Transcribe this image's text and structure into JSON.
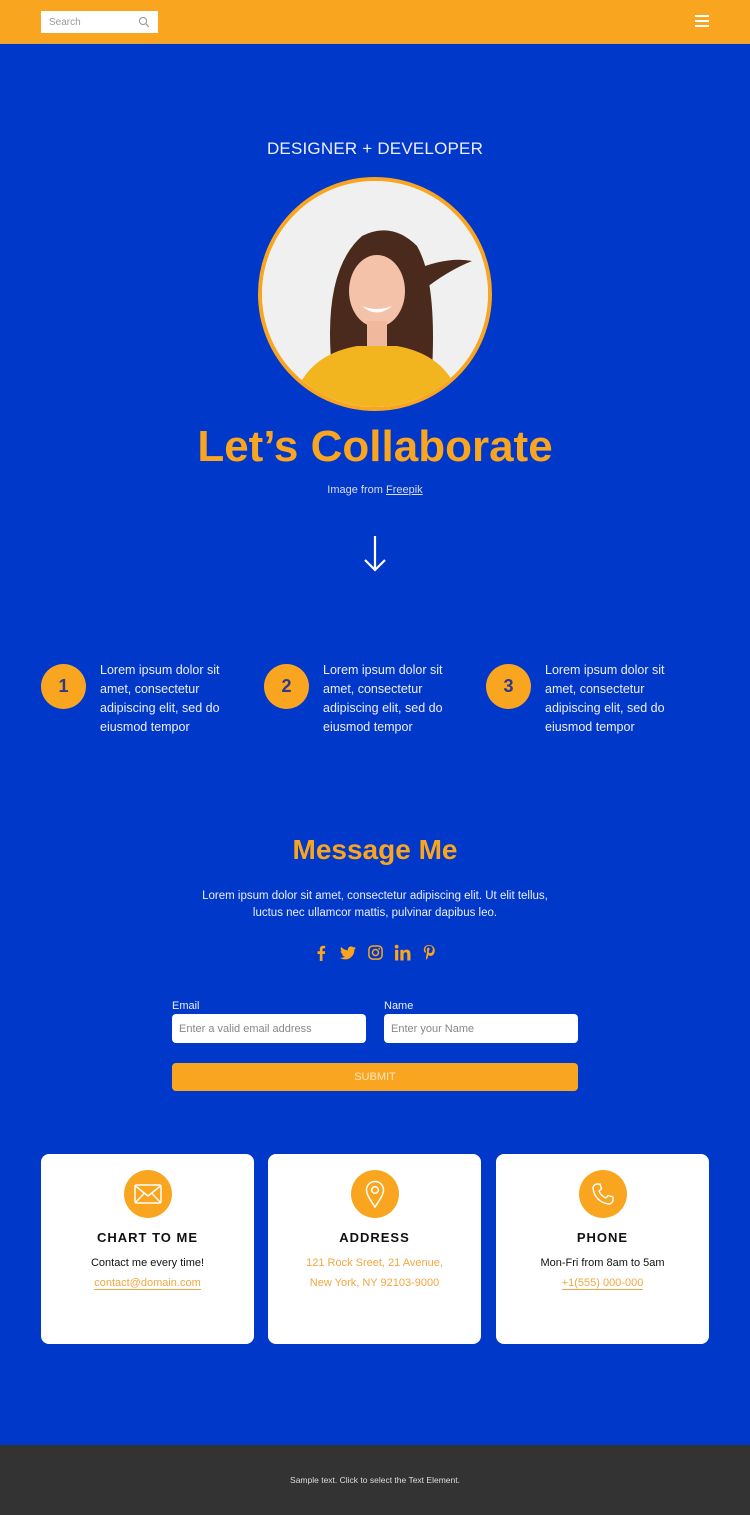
{
  "header": {
    "search_placeholder": "Search",
    "menu_icon": "hamburger-icon",
    "accent": "#faa51f"
  },
  "hero": {
    "tagline": "DESIGNER + DEVELOPER",
    "headline": "Let’s Collaborate",
    "credit_prefix": "Image from",
    "credit_link": "Freepik",
    "portrait_alt": "Smiling woman in yellow shirt",
    "arrow_icon": "arrow-down-icon"
  },
  "steps": [
    {
      "num": "1",
      "text": "Lorem ipsum dolor sit amet, consectetur adipiscing elit, sed do eiusmod tempor"
    },
    {
      "num": "2",
      "text": "Lorem ipsum dolor sit amet, consectetur adipiscing elit, sed do eiusmod tempor"
    },
    {
      "num": "3",
      "text": "Lorem ipsum dolor sit amet, consectetur adipiscing elit, sed do eiusmod tempor"
    }
  ],
  "message": {
    "title": "Message Me",
    "description": "Lorem ipsum dolor sit amet, consectetur adipiscing elit. Ut elit tellus, luctus nec ullamcor mattis, pulvinar dapibus leo.",
    "social": [
      "facebook-icon",
      "twitter-icon",
      "instagram-icon",
      "linkedin-icon",
      "pinterest-icon"
    ],
    "form": {
      "email_label": "Email",
      "email_placeholder": "Enter a valid email address",
      "name_label": "Name",
      "name_placeholder": "Enter your Name",
      "submit_label": "SUBMIT"
    }
  },
  "cards": [
    {
      "icon": "envelope-icon",
      "title": "CHART TO ME",
      "line1": "Contact me every time!",
      "link": "contact@domain.com"
    },
    {
      "icon": "map-pin-icon",
      "title": "ADDRESS",
      "line1": "121 Rock Sreet, 21 Avenue,",
      "line2": "New York, NY 92103-9000"
    },
    {
      "icon": "phone-icon",
      "title": "PHONE",
      "line1": "Mon-Fri from 8am to 5am",
      "link": "+1(555) 000-000"
    }
  ],
  "footer": {
    "text": "Sample text. Click to select the Text Element."
  }
}
